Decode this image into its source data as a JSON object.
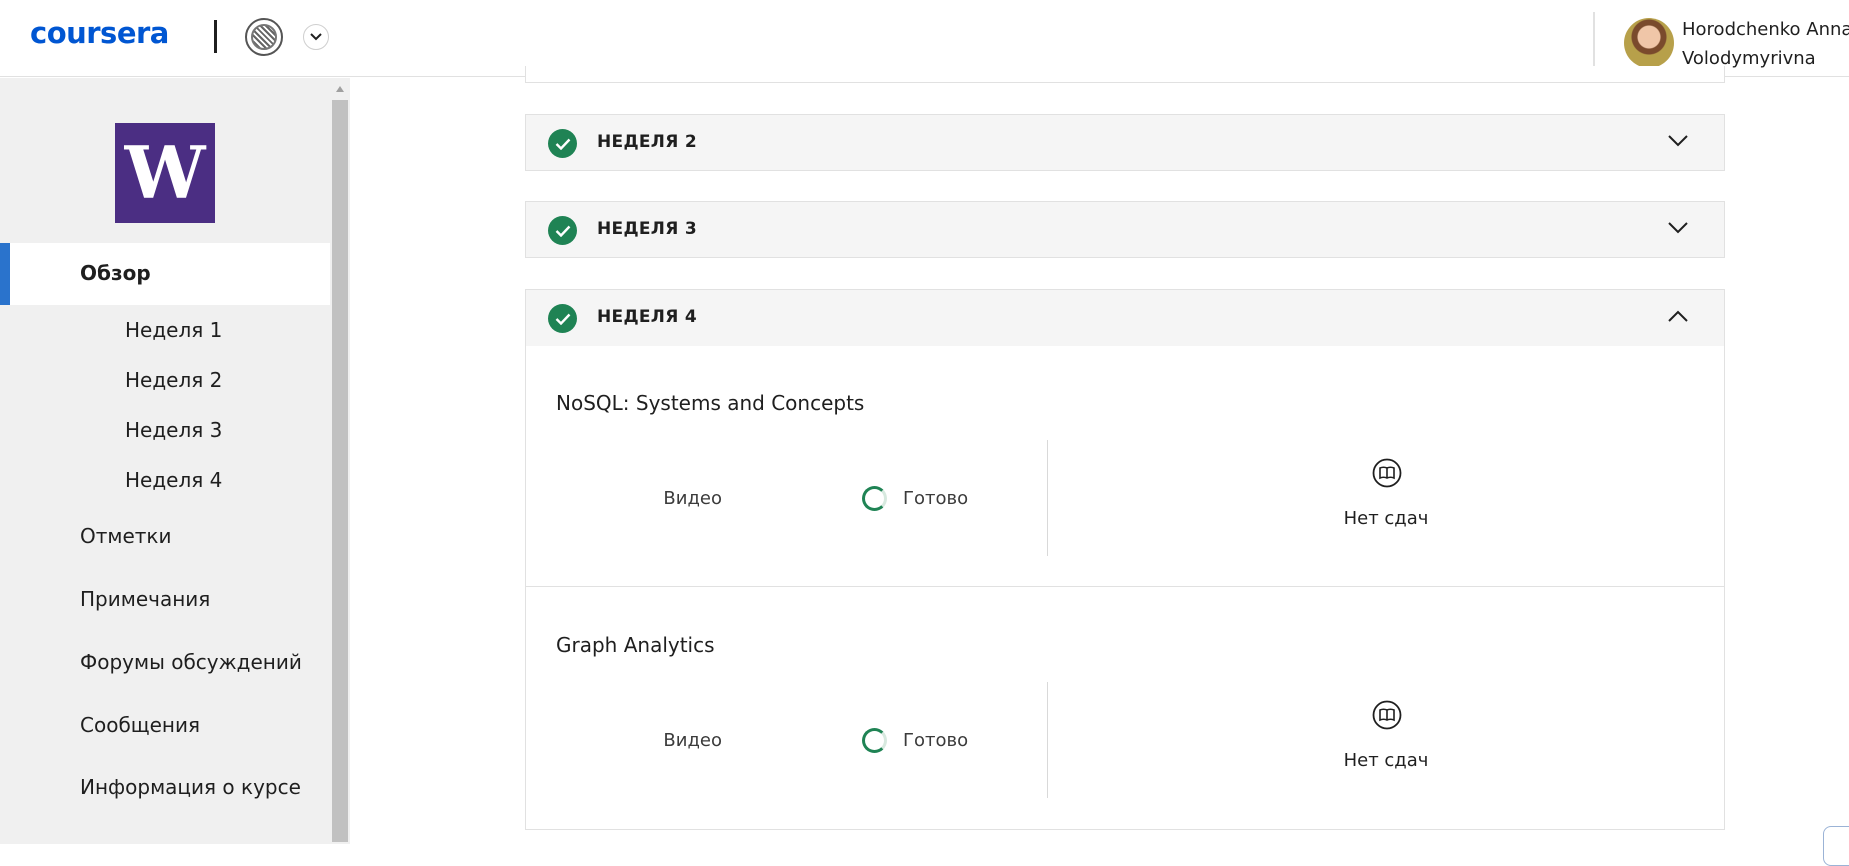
{
  "header": {
    "logo": "coursera",
    "university_seal_icon": "university-seal-icon",
    "switcher_icon": "chevron-down-icon",
    "user_name_line1": "Horodchenko Anna",
    "user_name_line2": "Volodymyrivna"
  },
  "sidebar": {
    "partner_logo_letter": "W",
    "active_item": "Обзор",
    "weeks": [
      "Неделя 1",
      "Неделя 2",
      "Неделя 3",
      "Неделя 4"
    ],
    "items": [
      "Отметки",
      "Примечания",
      "Форумы обсуждений",
      "Сообщения",
      "Информация о курсе"
    ]
  },
  "main": {
    "weeks": [
      {
        "title": "НЕДЕЛЯ 2",
        "completed": true,
        "expanded": false
      },
      {
        "title": "НЕДЕЛЯ 3",
        "completed": true,
        "expanded": false
      },
      {
        "title": "НЕДЕЛЯ 4",
        "completed": true,
        "expanded": true
      }
    ],
    "lessons": [
      {
        "title": "NoSQL: Systems and Concepts",
        "video_label": "Видео",
        "status": "Готово",
        "submissions": "Нет сдач"
      },
      {
        "title": "Graph Analytics",
        "video_label": "Видео",
        "status": "Готово",
        "submissions": "Нет сдач"
      }
    ]
  },
  "colors": {
    "brand": "#0056d2",
    "active_indicator": "#2a73cc",
    "success": "#1f8354",
    "partner_purple": "#4b2e83"
  }
}
